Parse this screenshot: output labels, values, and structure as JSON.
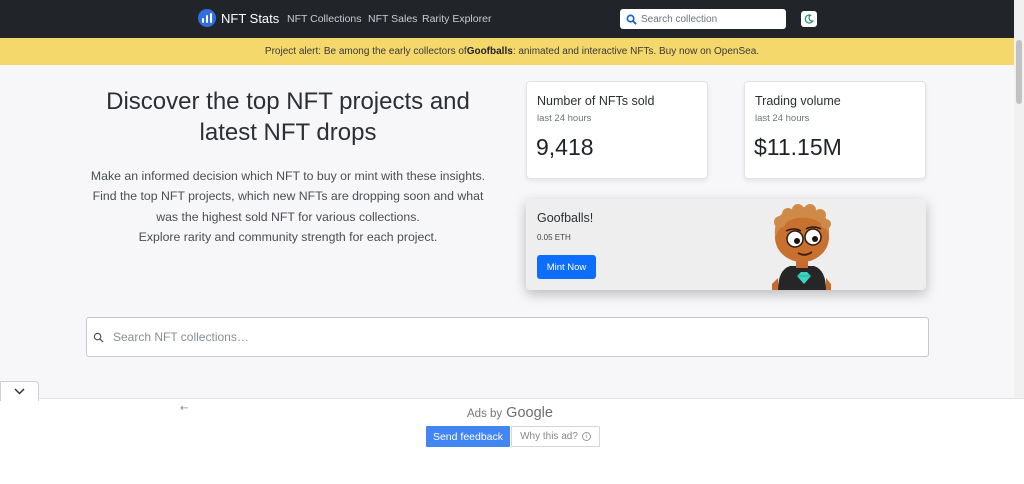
{
  "navbar": {
    "brand": "NFT Stats",
    "links": [
      "NFT Collections",
      "NFT Sales",
      "Rarity Explorer"
    ],
    "search_placeholder": "Search collection",
    "background": "#212529"
  },
  "alert": {
    "prefix": "Project alert: Be among the early collectors of ",
    "highlight": "Goofballs",
    "suffix": ": animated and interactive NFTs. Buy now on OpenSea.",
    "background": "#f5d86b"
  },
  "hero": {
    "title": "Discover the top NFT projects and latest NFT drops",
    "lines": [
      "Make an informed decision which NFT to buy or mint with these insights.",
      "Find the top NFT projects, which new NFTs are dropping soon and what",
      "was the highest sold NFT for various collections.",
      "Explore rarity and community strength for each project."
    ]
  },
  "stats": [
    {
      "title": "Number of NFTs sold",
      "period": "last 24 hours",
      "value": "9,418"
    },
    {
      "title": "Trading volume",
      "period": "last 24 hours",
      "value": "$11.15M"
    }
  ],
  "promo": {
    "title": "Goofballs!",
    "price": "0.05 ETH",
    "button": "Mint Now"
  },
  "main_search": {
    "placeholder": "Search NFT collections…"
  },
  "ad": {
    "ads_by": "Ads by",
    "google": "Google",
    "send_feedback": "Send feedback",
    "why_this_ad": "Why this ad?"
  },
  "colors": {
    "accent": "#0d6efd",
    "google_blue": "#4285f4"
  }
}
